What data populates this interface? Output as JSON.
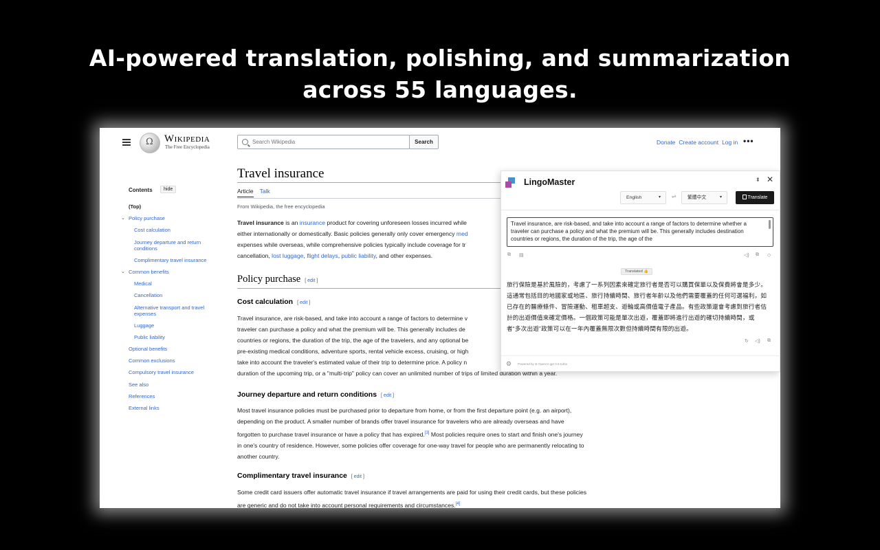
{
  "headline": {
    "line1": "AI-powered translation, polishing, and summarization",
    "line2": "across 55 languages."
  },
  "wikipedia": {
    "logo_word": "Wikipedia",
    "logo_tagline": "The Free Encyclopedia",
    "search_placeholder": "Search Wikipedia",
    "search_button": "Search",
    "links": [
      "Donate",
      "Create account",
      "Log in"
    ],
    "more": "•••"
  },
  "toc": {
    "title": "Contents",
    "hide": "hide",
    "items": [
      {
        "label": "(Top)",
        "level": "top"
      },
      {
        "label": "Policy purchase",
        "level": "lvl1",
        "arrow": "⌄"
      },
      {
        "label": "Cost calculation",
        "level": "lvl2"
      },
      {
        "label": "Journey departure and return conditions",
        "level": "lvl2"
      },
      {
        "label": "Complimentary travel insurance",
        "level": "lvl2"
      },
      {
        "label": "Common benefits",
        "level": "lvl1",
        "arrow": "⌄"
      },
      {
        "label": "Medical",
        "level": "lvl2"
      },
      {
        "label": "Cancellation",
        "level": "lvl2"
      },
      {
        "label": "Alternative transport and travel expenses",
        "level": "lvl2"
      },
      {
        "label": "Luggage",
        "level": "lvl2"
      },
      {
        "label": "Public liability",
        "level": "lvl2"
      },
      {
        "label": "Optional benefits",
        "level": "lvl1"
      },
      {
        "label": "Common exclusions",
        "level": "lvl1"
      },
      {
        "label": "Compulsory travel insurance",
        "level": "lvl1"
      },
      {
        "label": "See also",
        "level": "lvl1"
      },
      {
        "label": "References",
        "level": "lvl1"
      },
      {
        "label": "External links",
        "level": "lvl1"
      }
    ]
  },
  "article": {
    "title": "Travel insurance",
    "tab_article": "Article",
    "tab_talk": "Talk",
    "from": "From Wikipedia, the free encyclopedia",
    "intro": {
      "bold": "Travel insurance",
      "t1": " is an ",
      "link1": "insurance",
      "t2": " product for covering unforeseen losses incurred while",
      "t3": "either internationally or domestically. Basic policies generally only cover emergency",
      "link_med": "med",
      "t4": "expenses while overseas, while comprehensive policies typically include coverage for tr",
      "t5": "cancellation, ",
      "link2": "lost luggage",
      "link3": "flight delays",
      "link4": "public liability",
      "t6": ", and other expenses."
    },
    "h2_policy": "Policy purchase",
    "edit": "edit",
    "h3_cost": "Cost calculation",
    "cost_lines": [
      "Travel insurance, are risk-based, and take into account a range of factors to determine v",
      "traveler can purchase a policy and what the premium will be. This generally includes de",
      "countries or regions, the duration of the trip, the age of the travelers, and any optional be",
      "pre-existing medical conditions, adventure sports, rental vehicle excess, cruising, or high",
      "take into account the traveler's estimated value of their trip to determine price. A policy n",
      "duration of the upcoming trip, or a \"multi-trip\" policy can cover an unlimited number of trips of limited duration within a year."
    ],
    "h3_journey": "Journey departure and return conditions",
    "journey_lines": [
      "Most travel insurance policies must be purchased prior to departure from home, or from the first departure point (e.g. an airport),",
      "depending on the product. A smaller number of brands offer travel insurance for travelers who are already overseas and have",
      "forgotten to purchase travel insurance or have a policy that has expired.",
      "[3]",
      " Most policies require ones to start and finish one's journey",
      "in one's country of residence. However, some policies offer coverage for one-way travel for people who are permanently relocating to",
      "another country."
    ],
    "h3_comp": "Complimentary travel insurance",
    "comp_lines": [
      "Some credit card issuers offer automatic travel insurance if travel arrangements are paid for using their credit cards, but these policies",
      "are generic and do not take into account personal requirements and circumstances.",
      "[4]"
    ]
  },
  "lingomaster": {
    "name": "LingoMaster",
    "pin": "⬍",
    "close": "✕",
    "source_lang": "English",
    "target_lang": "繁體中文",
    "caret": "▾",
    "swap": "⇌",
    "translate_button": "Translate",
    "source_text": "Travel insurance, are risk-based, and take into account a range of factors to determine whether a traveler can purchase a policy and what the premium will be. This generally includes destination countries or regions, the duration of the trip, the age of the",
    "translated_badge": "Translated 👍",
    "output_text": "旅行保險是基於風險的，考慮了一系列因素來確定旅行者是否可以購買保單以及保費將會是多少。這通常包括目的地國家或地區、旅行持續時間、旅行者年齡以及他們需要覆蓋的任何可選福利，如已存在的醫療條件、冒險運動、租車超支、遊輪或高價值電子產品。有些政策還會考慮到旅行者估計的出遊價值來確定價格。一個政策可能是單次出遊，覆蓋即將進行出遊的確切持續時間，或者“多次出遊”政策可以在一年內覆蓋無限次數但持續時間有限的出遊。",
    "powered": "Powered by ⊛ OpenAI gpt-3.5-turbo"
  }
}
